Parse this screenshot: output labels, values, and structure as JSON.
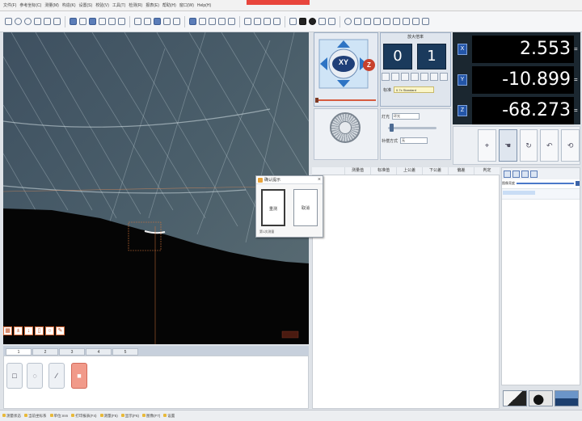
{
  "app": {
    "menu_items": [
      "文件(F)",
      "参考坐标(C)",
      "测量(M)",
      "构造(K)",
      "设置(S)",
      "校验(V)",
      "工具(T)",
      "检测(R)",
      "报表(E)",
      "帮助(H)",
      "窗口(W)",
      "Help(H)"
    ],
    "accent_color": "#e8453c"
  },
  "toolbar": {
    "icons": [
      "line-icon",
      "circle-icon",
      "arc-icon",
      "point-icon",
      "rect-icon",
      "angle-icon",
      "distance-icon",
      "gear-icon",
      "table-icon",
      "zoom-icon",
      "person-icon",
      "lock-icon",
      "camera-icon",
      "save-icon",
      "cursor-icon",
      "home-icon",
      "grid-icon",
      "report-icon"
    ]
  },
  "camera": {
    "tool_icons": [
      "grid-icon",
      "measure-icon",
      "download-icon",
      "page-icon",
      "zoom-icon",
      "pin-icon"
    ]
  },
  "bottom_tabs": [
    "1",
    "2",
    "3",
    "4",
    "5"
  ],
  "shape_tools": [
    "square-icon",
    "lens-icon",
    "pen-icon",
    "stop-icon"
  ],
  "joystick": {
    "label": "XY",
    "z_label": "Z"
  },
  "counters": {
    "title": "放大倍率",
    "left": "0",
    "right": "1",
    "std_label": "标准",
    "std_value": "0.7x Standard"
  },
  "settings": {
    "lens_label": "灯光",
    "lens_value": "环光",
    "mode_label": "补偿方式",
    "mode_value": "无"
  },
  "dro": {
    "x": {
      "axis": "X",
      "value": "2.553",
      "unit": "="
    },
    "y": {
      "axis": "Y",
      "value": "-10.899",
      "unit": "="
    },
    "z": {
      "axis": "Z",
      "value": "-68.273",
      "unit": "="
    }
  },
  "dro_buttons": [
    "target-icon",
    "hand-icon",
    "rotate-icon",
    "undo-icon",
    "reset-icon"
  ],
  "results": {
    "columns": [
      "测量值",
      "标准值",
      "上公差",
      "下公差",
      "偏差",
      "判定"
    ]
  },
  "right_panel": {
    "slider_label": "图像亮度"
  },
  "dialog": {
    "title": "确认提示",
    "close_label": "×",
    "yes_label": "重测",
    "no_label": "取消",
    "status": "第1次测量"
  },
  "statusbar": {
    "items": [
      "测量状态",
      "当前坐标系",
      "单位:mm",
      "打印报表(F4)",
      "测量(F5)",
      "显示(F6)",
      "图像(F7)",
      "设置"
    ]
  }
}
